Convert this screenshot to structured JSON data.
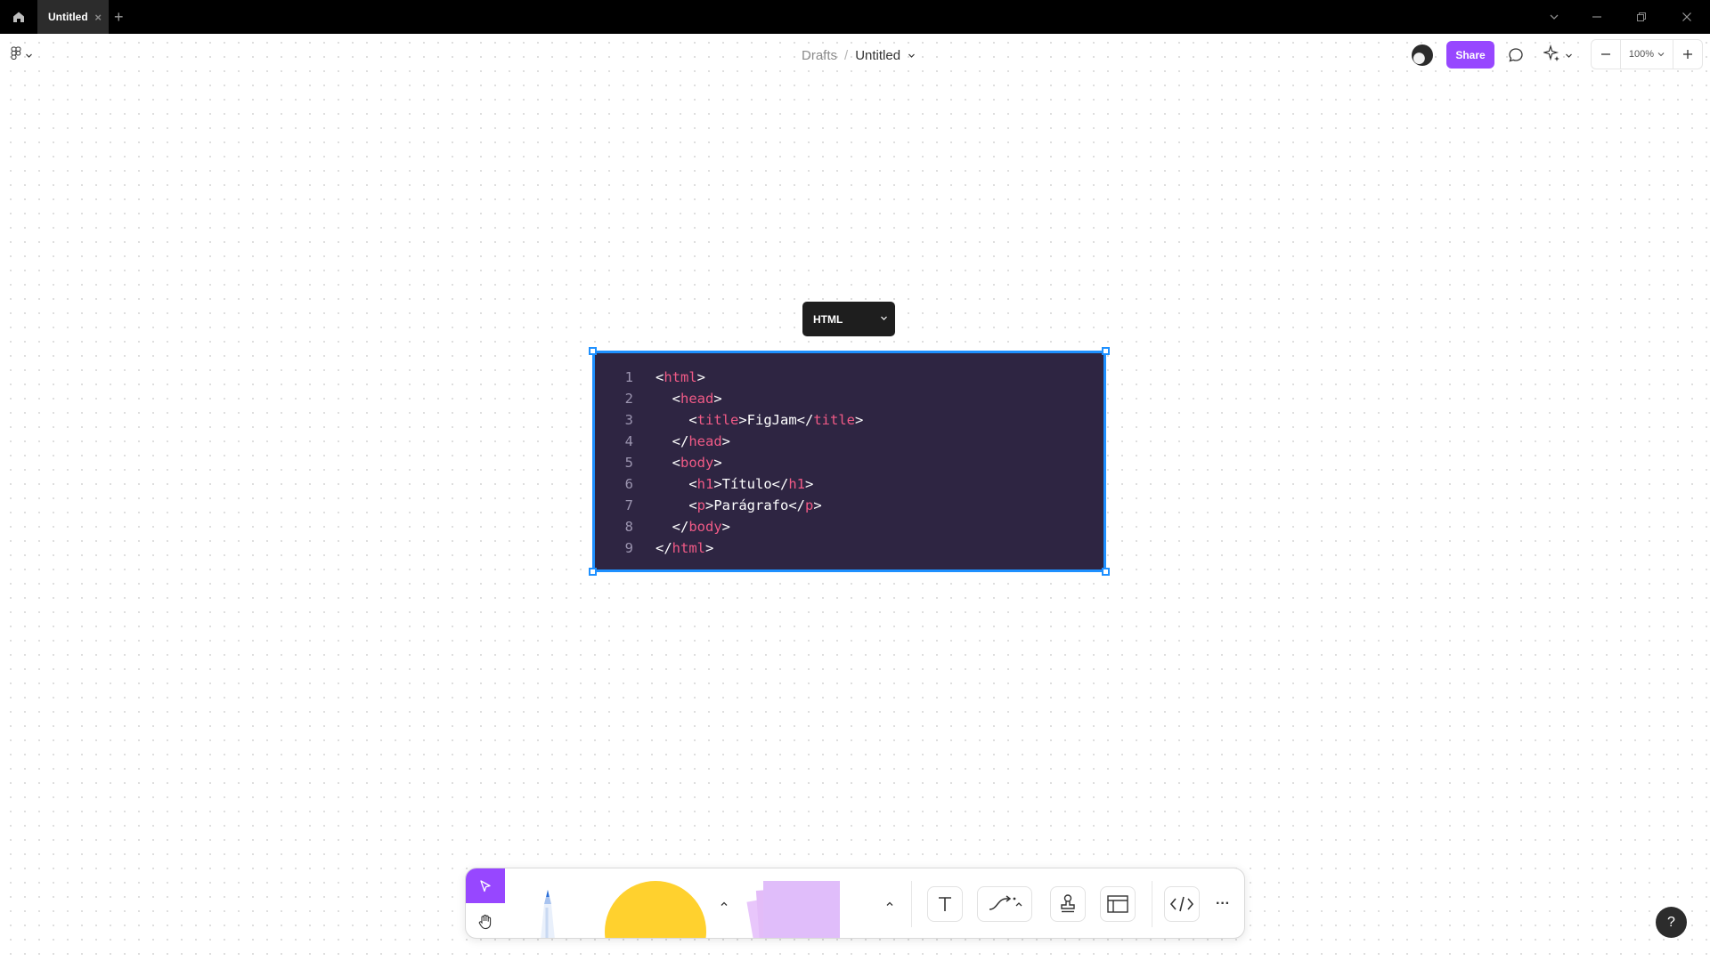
{
  "window": {
    "tab_title": "Untitled",
    "tab_close_glyph": "×",
    "new_tab_glyph": "+",
    "icons": [
      "home-icon",
      "chevron-down-icon",
      "minimize-icon",
      "restore-icon",
      "close-icon"
    ]
  },
  "header": {
    "breadcrumb_parent": "Drafts",
    "breadcrumb_separator": "/",
    "file_title": "Untitled",
    "share_label": "Share",
    "zoom_level": "100%",
    "accent_color": "#9747ff"
  },
  "code_block": {
    "language": "HTML",
    "lines": [
      {
        "n": "1",
        "parts": [
          {
            "t": "<"
          },
          {
            "t": "html",
            "tag": true
          },
          {
            "t": ">"
          }
        ]
      },
      {
        "n": "2",
        "parts": [
          {
            "t": "  <"
          },
          {
            "t": "head",
            "tag": true
          },
          {
            "t": ">"
          }
        ]
      },
      {
        "n": "3",
        "parts": [
          {
            "t": "    <"
          },
          {
            "t": "title",
            "tag": true
          },
          {
            "t": ">FigJam</"
          },
          {
            "t": "title",
            "tag": true
          },
          {
            "t": ">"
          }
        ]
      },
      {
        "n": "4",
        "parts": [
          {
            "t": "  </"
          },
          {
            "t": "head",
            "tag": true
          },
          {
            "t": ">"
          }
        ]
      },
      {
        "n": "5",
        "parts": [
          {
            "t": "  <"
          },
          {
            "t": "body",
            "tag": true
          },
          {
            "t": ">"
          }
        ]
      },
      {
        "n": "6",
        "parts": [
          {
            "t": "    <"
          },
          {
            "t": "h1",
            "tag": true
          },
          {
            "t": ">Título</"
          },
          {
            "t": "h1",
            "tag": true
          },
          {
            "t": ">"
          }
        ]
      },
      {
        "n": "7",
        "parts": [
          {
            "t": "    <"
          },
          {
            "t": "p",
            "tag": true
          },
          {
            "t": ">Parágrafo</"
          },
          {
            "t": "p",
            "tag": true
          },
          {
            "t": ">"
          }
        ]
      },
      {
        "n": "8",
        "parts": [
          {
            "t": "  </"
          },
          {
            "t": "body",
            "tag": true
          },
          {
            "t": ">"
          }
        ]
      },
      {
        "n": "9",
        "parts": [
          {
            "t": "</"
          },
          {
            "t": "html",
            "tag": true
          },
          {
            "t": ">"
          }
        ]
      }
    ],
    "background_color": "#2e2542",
    "tag_color": "#f05a86",
    "selection_color": "#1e90ff"
  },
  "toolbar": {
    "tools": [
      "select-tool",
      "hand-tool",
      "pencil-tool",
      "shape-tool",
      "sticky-note-tool",
      "text-tool",
      "connector-tool",
      "stamp-tool",
      "section-tool",
      "code-block-tool",
      "more-tools"
    ],
    "more_glyph": "···",
    "shape_color": "#ffd12e",
    "sticky_color": "#e0bdfa"
  },
  "help": {
    "label": "?"
  }
}
